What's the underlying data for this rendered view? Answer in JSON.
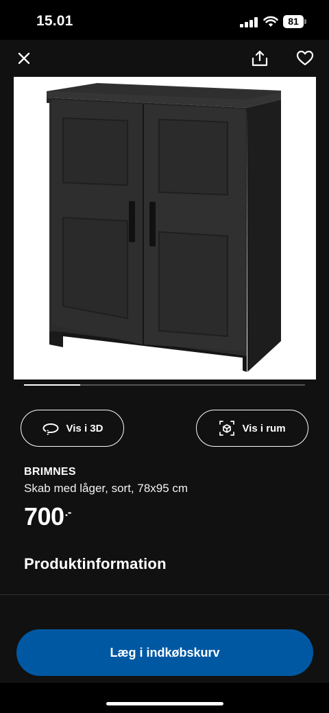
{
  "status_bar": {
    "time": "15.01",
    "battery": "81"
  },
  "header": {
    "close_icon": "close-icon",
    "share_icon": "share-icon",
    "favorite_icon": "heart-icon"
  },
  "image": {
    "carousel_progress": 0.2
  },
  "actions": {
    "view_3d_label": "Vis i 3D",
    "view_in_room_label": "Vis i rum"
  },
  "product": {
    "name": "BRIMNES",
    "description": "Skab med låger, sort, 78x95 cm",
    "price": "700",
    "price_suffix": ".-"
  },
  "sections": {
    "product_info_title": "Produktinformation"
  },
  "cart": {
    "add_label": "Læg i indkøbskurv"
  },
  "colors": {
    "accent": "#0058a3",
    "background": "#111111"
  }
}
